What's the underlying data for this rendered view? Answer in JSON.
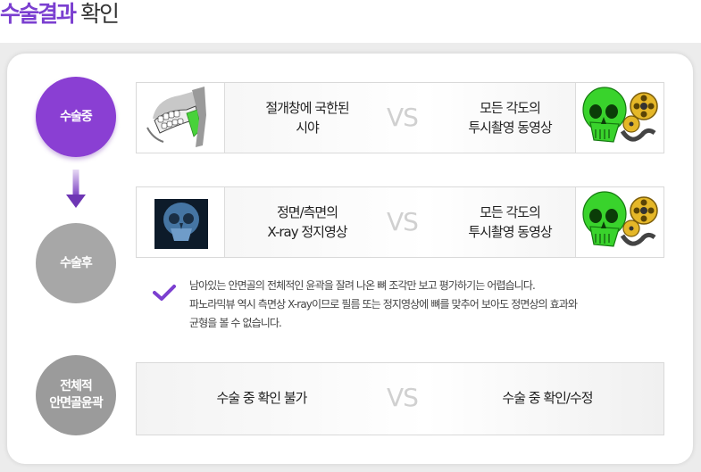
{
  "title": {
    "accent": "수술결과",
    "rest": " 확인"
  },
  "rows": {
    "surgery": {
      "label": "수술중",
      "left_line1": "절개창에 국한된",
      "left_line2": "시야",
      "vs": "VS",
      "right_line1": "모든 각도의",
      "right_line2": "투시촬영 동영상"
    },
    "after": {
      "label": "수술후",
      "left_line1": "정면/측면의",
      "left_line2": "X-ray 정지영상",
      "vs": "VS",
      "right_line1": "모든 각도의",
      "right_line2": "투시촬영 동영상"
    },
    "whole": {
      "label_line1": "전체적",
      "label_line2": "안면골윤곽",
      "left": "수술 중 확인 불가",
      "vs": "VS",
      "right": "수술 중 확인/수정"
    }
  },
  "note": {
    "line1": "남아있는 안면골의 전체적인 윤곽을 잘려 나온 뼈 조각만 보고 평가하기는 어렵습니다.",
    "line2": "파노라믹뷰 역시 측면상 X-ray이므로 필름 또는 정지영상에 뼈를 맞추어 보아도 정면상의 효과와",
    "line3": "균형을 볼 수 없습니다."
  },
  "colors": {
    "accent": "#8a3fd3",
    "gray_circle": "#a7a7a7",
    "skull": "#39d32c",
    "check": "#7b3fd0"
  },
  "icons": [
    "jaw-incision-icon",
    "skull-film-icon",
    "xray-skull-icon",
    "check-icon",
    "arrow-down-icon"
  ]
}
